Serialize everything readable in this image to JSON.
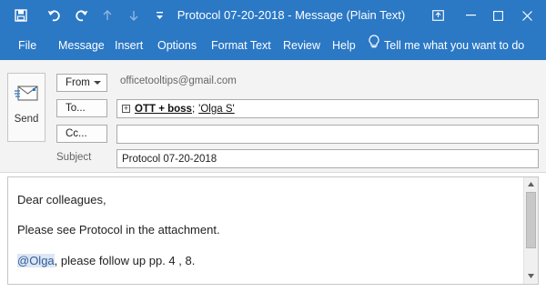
{
  "window": {
    "title": "Protocol 07-20-2018  -  Message (Plain Text)",
    "title_bar_color": "#2b78c5"
  },
  "quick_access": [
    "save-icon",
    "undo-icon",
    "redo-icon",
    "up-arrow-icon",
    "down-arrow-icon",
    "customize-toolbar-icon"
  ],
  "window_controls": [
    "ribbon-display-options-icon",
    "minimize-icon",
    "maximize-icon",
    "close-icon"
  ],
  "ribbon": {
    "tabs": [
      "File",
      "Message",
      "Insert",
      "Options",
      "Format Text",
      "Review",
      "Help"
    ],
    "tell_me": "Tell me what you want to do"
  },
  "header": {
    "send_label": "Send",
    "from_label": "From",
    "from_address": "officetooltips@gmail.com",
    "to_label": "To...",
    "cc_label": "Cc...",
    "subject_label": "Subject",
    "to_recipients": [
      "OTT + boss",
      "'Olga S'"
    ],
    "to_separator": ";",
    "cc_value": "",
    "subject_value": "Protocol 07-20-2018"
  },
  "body": {
    "line1": "Dear colleagues,",
    "line2": "Please see Protocol in the attachment.",
    "mention": "@Olga",
    "line3_rest": ", please follow up pp. 4 , 8."
  }
}
